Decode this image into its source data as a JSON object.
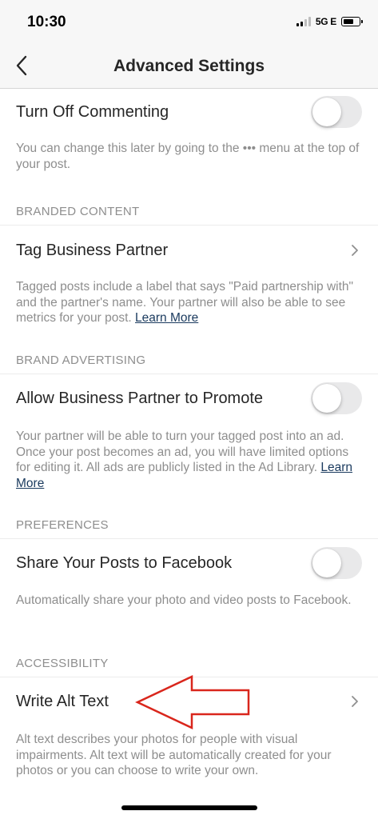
{
  "status_bar": {
    "time": "10:30",
    "network": "5G E"
  },
  "nav": {
    "title": "Advanced Settings",
    "back_icon": "chevron-left-icon"
  },
  "turn_off_commenting": {
    "label": "Turn Off Commenting",
    "enabled": false,
    "description": "You can change this later by going to the ••• menu at the top of your post."
  },
  "branded_content": {
    "header": "BRANDED CONTENT",
    "tag_partner_label": "Tag Business Partner",
    "description": "Tagged posts include a label that says \"Paid partnership with\" and the partner's name. Your partner will also be able to see metrics for your post. ",
    "link": "Learn More"
  },
  "brand_advertising": {
    "header": "BRAND ADVERTISING",
    "label": "Allow Business Partner to Promote",
    "enabled": false,
    "description": "Your partner will be able to turn your tagged post into an ad. Once your post becomes an ad, you will have limited options for editing it. All ads are publicly listed in the Ad Library. ",
    "link": "Learn More"
  },
  "preferences": {
    "header": "PREFERENCES",
    "label": "Share Your Posts to Facebook",
    "enabled": false,
    "description": "Automatically share your photo and video posts to Facebook."
  },
  "accessibility": {
    "header": "ACCESSIBILITY",
    "label": "Write Alt Text",
    "description": "Alt text describes your photos for people with visual impairments. Alt text will be automatically created for your photos or you can choose to write your own."
  },
  "colors": {
    "annotation_arrow": "#d9261c",
    "link": "#1a3a5e",
    "toggle_off": "#e9e9ea"
  }
}
